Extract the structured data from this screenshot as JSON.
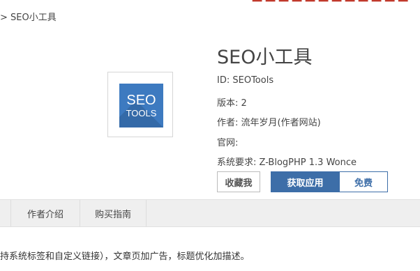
{
  "breadcrumb": {
    "separator": ">",
    "current": "SEO小工具"
  },
  "app": {
    "title": "SEO小工具",
    "id_label": "ID:",
    "id_value": "SEOTools",
    "version_label": "版本:",
    "version_value": "2",
    "author_label": "作者:",
    "author_value": "流年岁月(作者网站)",
    "website_label": "官网:",
    "website_value": "",
    "requirement_label": "系统要求:",
    "requirement_value": "Z-BlogPHP 1.3 Wonce"
  },
  "logo": {
    "line1": "SEO",
    "line2": "TOOLS",
    "bg_color": "#3d7ac0"
  },
  "buttons": {
    "favorite": "收藏我",
    "get": "获取应用",
    "price": "免费"
  },
  "tabs": [
    {
      "label": "作者介绍"
    },
    {
      "label": "购买指南"
    }
  ],
  "description": "持系统标签和自定义链接），文章页加广告，标题优化加描述。",
  "colors": {
    "accent": "#3d6ea8",
    "tab_bg": "#efefef"
  }
}
